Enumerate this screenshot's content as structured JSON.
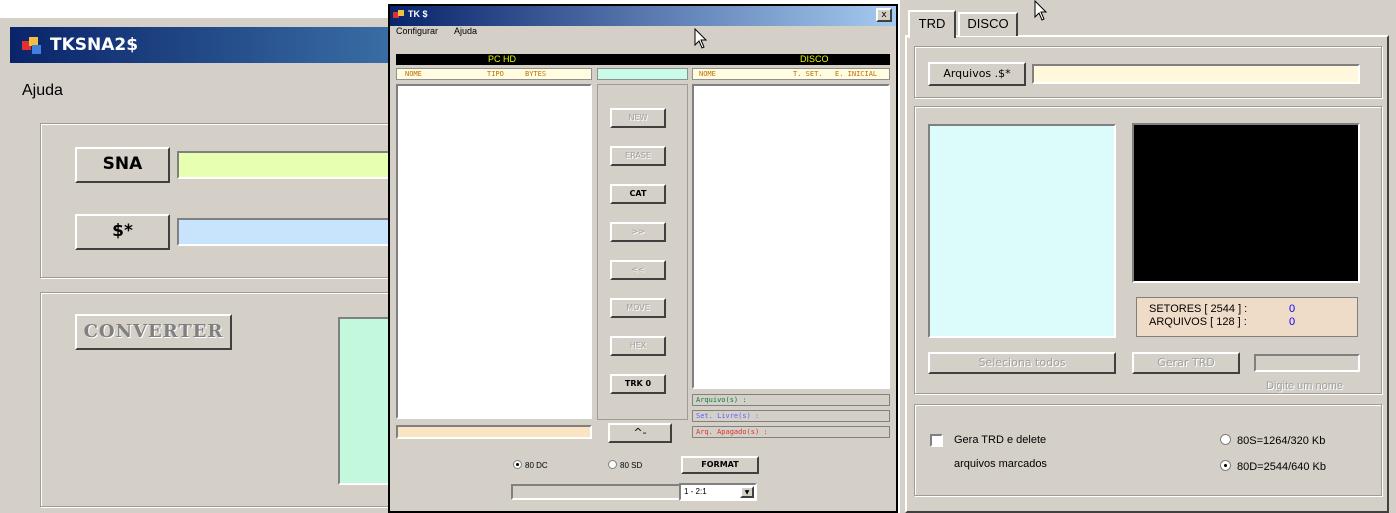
{
  "window1": {
    "title": "TKSNA2$",
    "menu": "Ajuda",
    "sna_label": "SNA",
    "dollar_label": "$*",
    "convert_label": "CONVERTER"
  },
  "window2": {
    "title": "TK $",
    "close_glyph": "x",
    "menu": [
      "Configurar",
      "Ajuda"
    ],
    "panel_left_title": "PC HD",
    "panel_right_title": "DISCO",
    "left_columns": [
      "NOME",
      "TIPO",
      "BYTES"
    ],
    "right_columns": [
      "NOME",
      "T. SET.",
      "E. INICIAL"
    ],
    "buttons": {
      "new": "NEW",
      "erase": "ERASE",
      "cat": "CAT",
      "forward": ">>",
      "back": "<<",
      "move": "MOVE",
      "hex": "HEX",
      "trk": "TRK 0",
      "lambda": "^-",
      "format": "FORMAT"
    },
    "status": {
      "arquivos": "Arquivo(s) :",
      "livres": "Set. Livre(s) :",
      "apagados": "Arq. Apagado(s) :"
    },
    "radio_80dc": "80 DC",
    "radio_80sd": "80 SD",
    "interleave": "1 - 2:1",
    "colors": {
      "arquivos": "#008040",
      "livres": "#6060ff",
      "apagados": "#e03030",
      "header_text": "#e8f800"
    }
  },
  "window3": {
    "tab_trd": "TRD",
    "tab_disco": "DISCO",
    "arquivos_button": "Arquivos .$*",
    "setores_label": "SETORES [ 2544 ] :",
    "setores_value": "0",
    "arquivos_label": "ARQUIVOS [ 128 ] :",
    "arquivos_value": "0",
    "seleciona_todos": "Seleciona todos",
    "gerar_trd": "Gerar TRD",
    "digite_nome": "Digite um nome",
    "checkbox_label_line1": "Gera TRD e delete",
    "checkbox_label_line2": "arquivos marcados",
    "option_80s": "80S=1264/320 Kb",
    "option_80d": "80D=2544/640 Kb"
  }
}
